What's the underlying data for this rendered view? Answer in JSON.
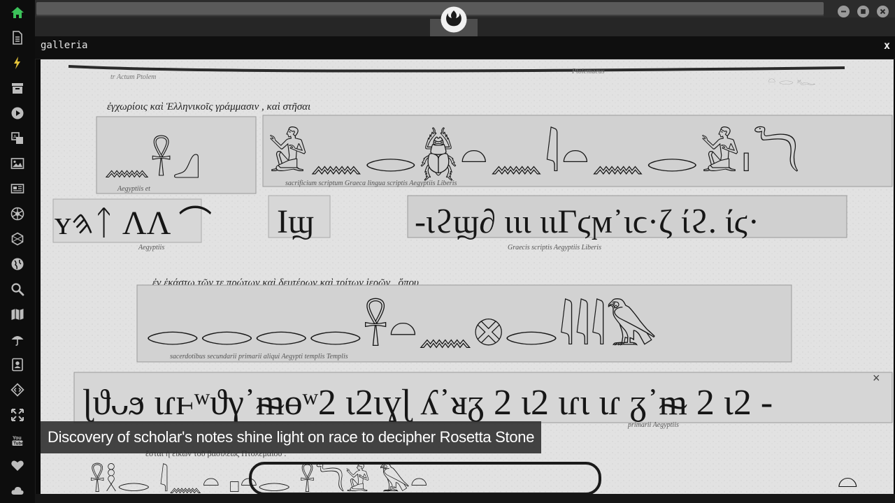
{
  "app": {
    "logo_icon": "rebel-alliance-icon"
  },
  "sidebar": {
    "accent_color": "#3cc25a",
    "items": [
      {
        "name": "home",
        "icon": "home-icon"
      },
      {
        "name": "document",
        "icon": "document-icon"
      },
      {
        "name": "flash",
        "icon": "lightning-icon"
      },
      {
        "name": "archive",
        "icon": "archive-icon"
      },
      {
        "name": "play",
        "icon": "play-icon"
      },
      {
        "name": "translate",
        "icon": "translate-icon"
      },
      {
        "name": "image",
        "icon": "image-icon"
      },
      {
        "name": "news",
        "icon": "newspaper-icon"
      },
      {
        "name": "rebel",
        "icon": "rebel-icon"
      },
      {
        "name": "hexagon",
        "icon": "hexagon-icon"
      },
      {
        "name": "globe",
        "icon": "globe-icon"
      },
      {
        "name": "search",
        "icon": "search-icon"
      },
      {
        "name": "map",
        "icon": "map-icon"
      },
      {
        "name": "umbrella",
        "icon": "umbrella-icon"
      },
      {
        "name": "contact",
        "icon": "contact-icon"
      },
      {
        "name": "code",
        "icon": "code-icon"
      },
      {
        "name": "expand",
        "icon": "expand-icon"
      },
      {
        "name": "youtube",
        "icon": "youtube-icon"
      },
      {
        "name": "favorites",
        "icon": "heart-icon"
      },
      {
        "name": "cloud",
        "icon": "cloud-icon"
      }
    ]
  },
  "panel": {
    "title": "galleria",
    "close_label": "x"
  },
  "gallery": {
    "caption": "Discovery of scholar's notes shine light on race to decipher Rosetta Stone",
    "image_close_label": "×",
    "greek_line_1": "ἐγχωρίοις καὶ Ἑλληνικοῖς γράμμασιν , καὶ στῆσαι",
    "greek_line_2": "ἐν ἑκάστῳ τῶν τε πρώτων καὶ δευτέρων καὶ τρίτων ἱερῶν , ὅπου"
  },
  "window": {
    "buttons": [
      "minimize",
      "maximize",
      "close"
    ]
  }
}
